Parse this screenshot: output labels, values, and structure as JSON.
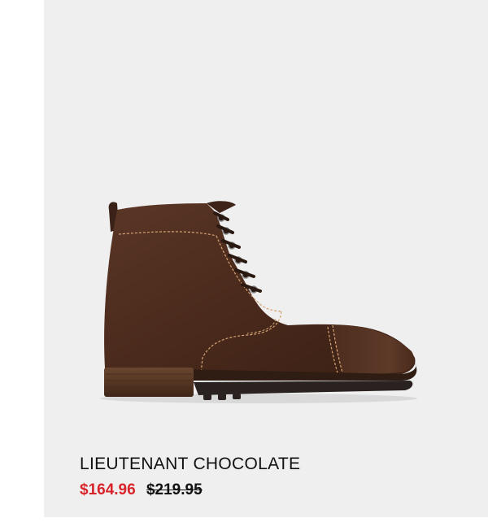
{
  "product": {
    "image_name": "lieutenant-chocolate-boot-image",
    "name": "LIEUTENANT CHOCOLATE",
    "sale_price": "$164.96",
    "original_price": "$219.95"
  },
  "colors": {
    "background": "#efefef",
    "sale_price": "#d8232a",
    "text": "#111111",
    "leather": "#4a2a1c"
  }
}
